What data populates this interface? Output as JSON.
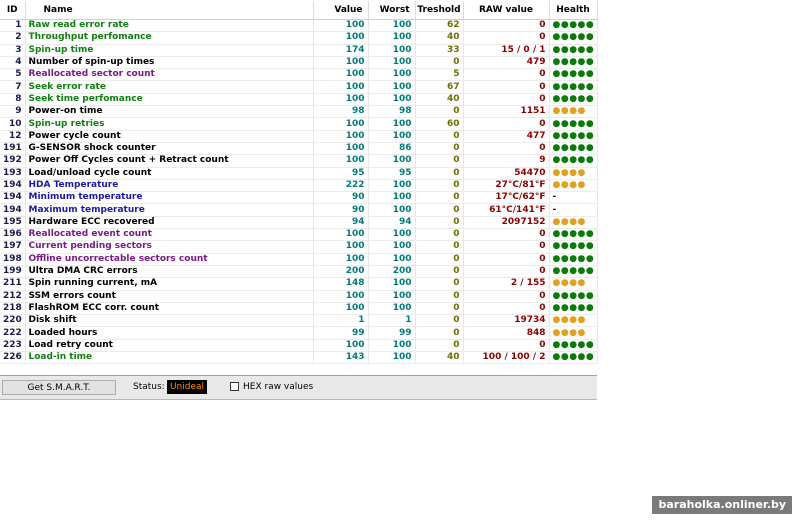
{
  "columns": {
    "id": "ID",
    "name": "Name",
    "value": "Value",
    "worst": "Worst",
    "treshold": "Treshold",
    "raw": "RAW value",
    "health": "Health"
  },
  "attributes": [
    {
      "id": "1",
      "name": "Raw read error rate",
      "value": "100",
      "worst": "100",
      "treshold": "62",
      "raw": "0",
      "health": "●●●●●",
      "name_color": "green",
      "health_level": "ok"
    },
    {
      "id": "2",
      "name": "Throughput perfomance",
      "value": "100",
      "worst": "100",
      "treshold": "40",
      "raw": "0",
      "health": "●●●●●",
      "name_color": "green",
      "health_level": "ok"
    },
    {
      "id": "3",
      "name": "Spin-up time",
      "value": "174",
      "worst": "100",
      "treshold": "33",
      "raw": "15 / 0 / 1",
      "health": "●●●●●",
      "name_color": "green",
      "health_level": "ok"
    },
    {
      "id": "4",
      "name": "Number of spin-up times",
      "value": "100",
      "worst": "100",
      "treshold": "0",
      "raw": "479",
      "health": "●●●●●",
      "name_color": "black",
      "health_level": "ok"
    },
    {
      "id": "5",
      "name": "Reallocated sector count",
      "value": "100",
      "worst": "100",
      "treshold": "5",
      "raw": "0",
      "health": "●●●●●",
      "name_color": "purple",
      "health_level": "ok"
    },
    {
      "id": "7",
      "name": "Seek error rate",
      "value": "100",
      "worst": "100",
      "treshold": "67",
      "raw": "0",
      "health": "●●●●●",
      "name_color": "green",
      "health_level": "ok"
    },
    {
      "id": "8",
      "name": "Seek time perfomance",
      "value": "100",
      "worst": "100",
      "treshold": "40",
      "raw": "0",
      "health": "●●●●●",
      "name_color": "green",
      "health_level": "ok"
    },
    {
      "id": "9",
      "name": "Power-on time",
      "value": "98",
      "worst": "98",
      "treshold": "0",
      "raw": "1151",
      "health": "●●●●",
      "name_color": "black",
      "health_level": "warn"
    },
    {
      "id": "10",
      "name": "Spin-up retries",
      "value": "100",
      "worst": "100",
      "treshold": "60",
      "raw": "0",
      "health": "●●●●●",
      "name_color": "green",
      "health_level": "ok"
    },
    {
      "id": "12",
      "name": "Power cycle count",
      "value": "100",
      "worst": "100",
      "treshold": "0",
      "raw": "477",
      "health": "●●●●●",
      "name_color": "black",
      "health_level": "ok"
    },
    {
      "id": "191",
      "name": "G-SENSOR shock counter",
      "value": "100",
      "worst": "86",
      "treshold": "0",
      "raw": "0",
      "health": "●●●●●",
      "name_color": "black",
      "health_level": "ok"
    },
    {
      "id": "192",
      "name": "Power Off Cycles count + Retract count",
      "value": "100",
      "worst": "100",
      "treshold": "0",
      "raw": "9",
      "health": "●●●●●",
      "name_color": "black",
      "health_level": "ok"
    },
    {
      "id": "193",
      "name": "Load/unload cycle count",
      "value": "95",
      "worst": "95",
      "treshold": "0",
      "raw": "54470",
      "health": "●●●●",
      "name_color": "black",
      "health_level": "warn"
    },
    {
      "id": "194",
      "name": "HDA Temperature",
      "value": "222",
      "worst": "100",
      "treshold": "0",
      "raw": "27°C/81°F",
      "health": "●●●●",
      "name_color": "blue",
      "health_level": "warn"
    },
    {
      "id": "194",
      "name": "Minimum temperature",
      "value": "90",
      "worst": "100",
      "treshold": "0",
      "raw": "17°C/62°F",
      "health": "-",
      "name_color": "blue",
      "health_level": "none"
    },
    {
      "id": "194",
      "name": "Maximum temperature",
      "value": "90",
      "worst": "100",
      "treshold": "0",
      "raw": "61°C/141°F",
      "health": "-",
      "name_color": "blue",
      "health_level": "none"
    },
    {
      "id": "195",
      "name": "Hardware ECC recovered",
      "value": "94",
      "worst": "94",
      "treshold": "0",
      "raw": "2097152",
      "health": "●●●●",
      "name_color": "black",
      "health_level": "warn"
    },
    {
      "id": "196",
      "name": "Reallocated event count",
      "value": "100",
      "worst": "100",
      "treshold": "0",
      "raw": "0",
      "health": "●●●●●",
      "name_color": "purple",
      "health_level": "ok"
    },
    {
      "id": "197",
      "name": "Current pending sectors",
      "value": "100",
      "worst": "100",
      "treshold": "0",
      "raw": "0",
      "health": "●●●●●",
      "name_color": "purple",
      "health_level": "ok"
    },
    {
      "id": "198",
      "name": "Offline uncorrectable sectors count",
      "value": "100",
      "worst": "100",
      "treshold": "0",
      "raw": "0",
      "health": "●●●●●",
      "name_color": "purple",
      "health_level": "ok"
    },
    {
      "id": "199",
      "name": "Ultra DMA CRC errors",
      "value": "200",
      "worst": "200",
      "treshold": "0",
      "raw": "0",
      "health": "●●●●●",
      "name_color": "black",
      "health_level": "ok"
    },
    {
      "id": "211",
      "name": "Spin running current, mA",
      "value": "148",
      "worst": "100",
      "treshold": "0",
      "raw": "2 / 155",
      "health": "●●●●",
      "name_color": "black",
      "health_level": "warn"
    },
    {
      "id": "212",
      "name": "SSM errors count",
      "value": "100",
      "worst": "100",
      "treshold": "0",
      "raw": "0",
      "health": "●●●●●",
      "name_color": "black",
      "health_level": "ok"
    },
    {
      "id": "218",
      "name": "FlashROM ECC corr. count",
      "value": "100",
      "worst": "100",
      "treshold": "0",
      "raw": "0",
      "health": "●●●●●",
      "name_color": "black",
      "health_level": "ok"
    },
    {
      "id": "220",
      "name": "Disk shift",
      "value": "1",
      "worst": "1",
      "treshold": "0",
      "raw": "19734",
      "health": "●●●●",
      "name_color": "black",
      "health_level": "warn"
    },
    {
      "id": "222",
      "name": "Loaded hours",
      "value": "99",
      "worst": "99",
      "treshold": "0",
      "raw": "848",
      "health": "●●●●",
      "name_color": "black",
      "health_level": "warn"
    },
    {
      "id": "223",
      "name": "Load retry count",
      "value": "100",
      "worst": "100",
      "treshold": "0",
      "raw": "0",
      "health": "●●●●●",
      "name_color": "black",
      "health_level": "ok"
    },
    {
      "id": "226",
      "name": "Load-in time",
      "value": "143",
      "worst": "100",
      "treshold": "40",
      "raw": "100 / 100 / 2",
      "health": "●●●●●",
      "name_color": "green",
      "health_level": "ok"
    }
  ],
  "statusbar": {
    "get_button": "Get S.M.A.R.T.",
    "status_label": "Status:",
    "status_value": "Unideal",
    "hex_label": "HEX raw values",
    "hex_checked": false
  },
  "watermark": "baraholka.onliner.by",
  "colors": {
    "status_bg": "#000000",
    "status_text": "#ff8c00",
    "health_ok": "#0a7a0a",
    "health_warn": "#e0a020"
  }
}
